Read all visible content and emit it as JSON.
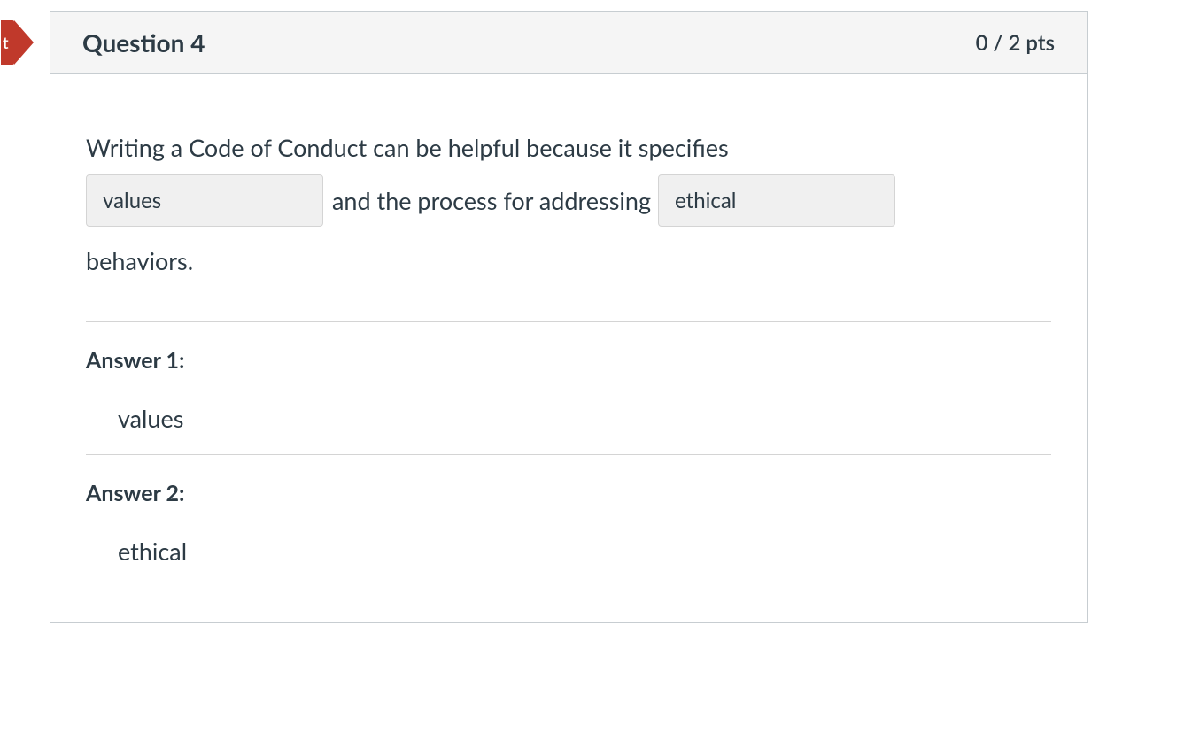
{
  "flag_label": "t",
  "header": {
    "title": "Question 4",
    "points": "0 / 2 pts"
  },
  "prompt": {
    "line1": "Writing a Code of Conduct can be helpful because it specifies",
    "blank1": "values",
    "mid": "and the process for addressing",
    "blank2": "ethical",
    "tail": "behaviors."
  },
  "answers": [
    {
      "label": "Answer 1:",
      "value": "values"
    },
    {
      "label": "Answer 2:",
      "value": "ethical"
    }
  ]
}
